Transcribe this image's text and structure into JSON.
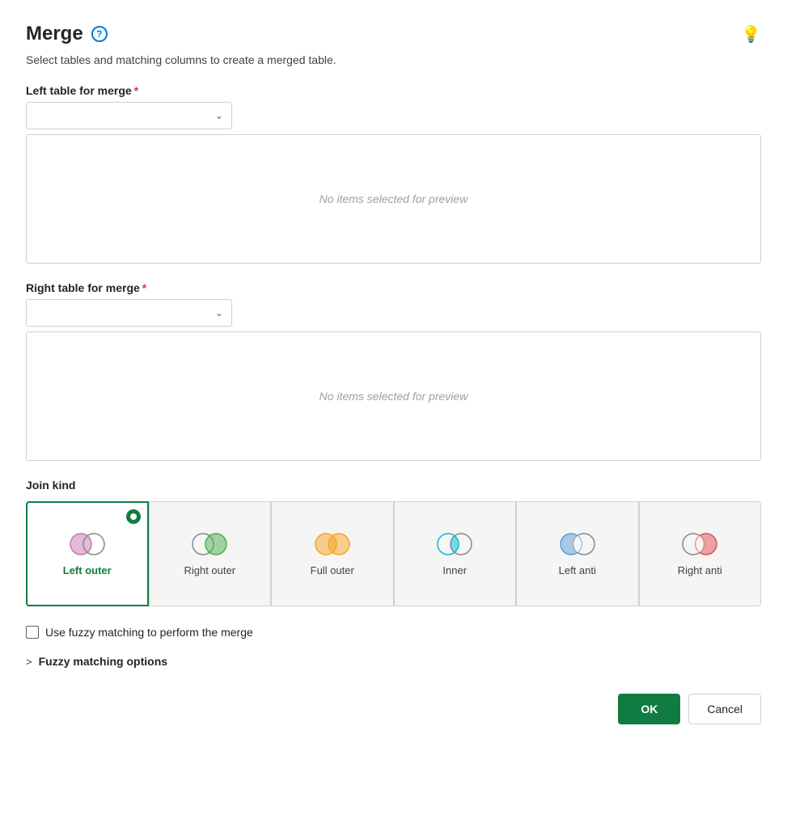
{
  "header": {
    "title": "Merge",
    "help_icon_label": "?",
    "subtitle": "Select tables and matching columns to create a merged table.",
    "lightbulb_icon_label": "💡"
  },
  "left_table": {
    "label": "Left table for merge",
    "required": true,
    "placeholder": "",
    "preview_text": "No items selected for preview"
  },
  "right_table": {
    "label": "Right table for merge",
    "required": true,
    "placeholder": "",
    "preview_text": "No items selected for preview"
  },
  "join_kind": {
    "label": "Join kind",
    "options": [
      {
        "id": "left-outer",
        "name": "Left outer",
        "selected": true
      },
      {
        "id": "right-outer",
        "name": "Right outer",
        "selected": false
      },
      {
        "id": "full-outer",
        "name": "Full outer",
        "selected": false
      },
      {
        "id": "inner",
        "name": "Inner",
        "selected": false
      },
      {
        "id": "left-anti",
        "name": "Left anti",
        "selected": false
      },
      {
        "id": "right-anti",
        "name": "Right anti",
        "selected": false
      }
    ]
  },
  "fuzzy": {
    "checkbox_label": "Use fuzzy matching to perform the merge",
    "options_label": "Fuzzy matching options",
    "options_prefix": ">"
  },
  "buttons": {
    "ok": "OK",
    "cancel": "Cancel"
  }
}
